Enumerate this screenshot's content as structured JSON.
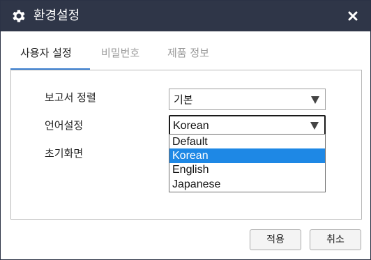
{
  "window": {
    "title": "환경설정",
    "icon": "gear-icon",
    "close_icon": "close-icon"
  },
  "tabs": [
    {
      "label": "사용자 설정",
      "active": true
    },
    {
      "label": "비밀번호",
      "active": false
    },
    {
      "label": "제품 정보",
      "active": false
    }
  ],
  "settings": {
    "report_sort": {
      "label": "보고서 정렬",
      "value": "기본"
    },
    "language": {
      "label": "언어설정",
      "value": "Korean",
      "options": [
        "Default",
        "Korean",
        "English",
        "Japanese"
      ],
      "selected_index": 1
    },
    "home_screen": {
      "label": "초기화면"
    }
  },
  "buttons": {
    "apply": "적용",
    "cancel": "취소"
  },
  "colors": {
    "titlebar": "#2f3648",
    "accent": "#3b7fd0",
    "selected_option": "#1e88e5"
  }
}
